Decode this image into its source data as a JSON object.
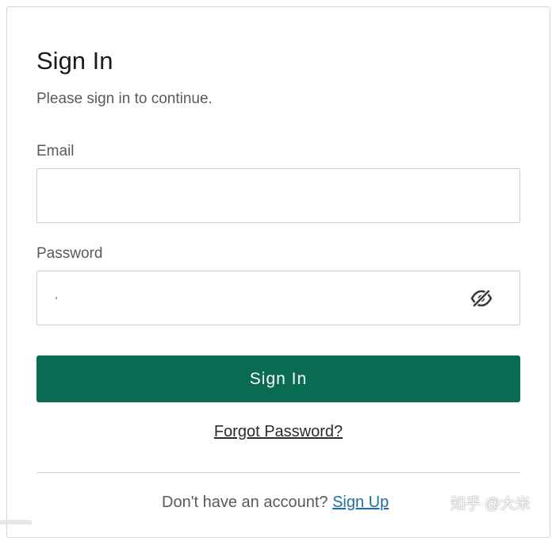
{
  "header": {
    "title": "Sign In",
    "subtitle": "Please sign in to continue."
  },
  "form": {
    "email_label": "Email",
    "email_value": "",
    "password_label": "Password",
    "password_value": "",
    "password_toggle_icon": "eye-slash-icon",
    "submit_label": "Sign In",
    "forgot_label": "Forgot Password?"
  },
  "footer": {
    "prompt": "Don't have an account?",
    "signup_label": "Sign Up"
  },
  "watermark": "知乎 @大米",
  "colors": {
    "primary": "#096b52",
    "link": "#1f6fa3"
  }
}
